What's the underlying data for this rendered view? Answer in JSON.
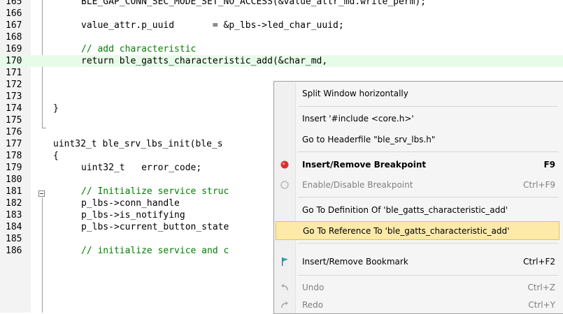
{
  "editor": {
    "lines": [
      {
        "num": "165",
        "code": "BLE_GAP_CONN_SEC_MODE_SET_NO_ACCESS(&value_attr_md.write_perm);",
        "kind": "plain"
      },
      {
        "num": "166",
        "code": "",
        "kind": "plain"
      },
      {
        "num": "167",
        "code": "value_attr.p_uuid       = &p_lbs->led_char_uuid;",
        "kind": "plain"
      },
      {
        "num": "168",
        "code": "",
        "kind": "plain"
      },
      {
        "num": "169",
        "code": "// add characteristic",
        "kind": "comment"
      },
      {
        "num": "170",
        "code": "return ble_gatts_characteristic_add(&char_md,",
        "kind": "highlight"
      },
      {
        "num": "171",
        "code": "",
        "kind": "plain"
      },
      {
        "num": "172",
        "code": "",
        "kind": "plain"
      },
      {
        "num": "173",
        "code": "",
        "kind": "plain"
      },
      {
        "num": "174",
        "code": "}",
        "kind": "plain"
      },
      {
        "num": "175",
        "code": "",
        "kind": "plain"
      },
      {
        "num": "176",
        "code": "",
        "kind": "plain"
      },
      {
        "num": "177",
        "code": "uint32_t ble_srv_lbs_init(ble_s",
        "kind": "plain"
      },
      {
        "num": "178",
        "code": "{",
        "kind": "plain"
      },
      {
        "num": "179",
        "code": "uint32_t   error_code;",
        "kind": "plain"
      },
      {
        "num": "180",
        "code": "",
        "kind": "plain"
      },
      {
        "num": "181",
        "code": "// Initialize service struc",
        "kind": "comment"
      },
      {
        "num": "182",
        "code": "p_lbs->conn_handle",
        "kind": "plain"
      },
      {
        "num": "183",
        "code": "p_lbs->is_notifying",
        "kind": "plain"
      },
      {
        "num": "184",
        "code": "p_lbs->current_button_state",
        "kind": "plain"
      },
      {
        "num": "185",
        "code": "",
        "kind": "plain"
      },
      {
        "num": "186",
        "code": "// initialize service and c",
        "kind": "comment"
      }
    ],
    "paren_glyph": ")"
  },
  "context_menu": {
    "items": [
      {
        "label": "Split Window horizontally",
        "shortcut": "",
        "bold": false,
        "disabled": false,
        "icon": ""
      },
      {
        "label": "Insert '#include <core.h>'",
        "shortcut": "",
        "bold": false,
        "disabled": false,
        "icon": ""
      },
      {
        "label": "Go to Headerfile \"ble_srv_lbs.h\"",
        "shortcut": "",
        "bold": false,
        "disabled": false,
        "icon": ""
      },
      {
        "label": "Insert/Remove Breakpoint",
        "shortcut": "F9",
        "bold": true,
        "disabled": false,
        "icon": "breakpoint-red-dot-icon"
      },
      {
        "label": "Enable/Disable Breakpoint",
        "shortcut": "Ctrl+F9",
        "bold": false,
        "disabled": true,
        "icon": "breakpoint-hollow-circle-icon"
      },
      {
        "label": "Go To Definition Of 'ble_gatts_characteristic_add'",
        "shortcut": "",
        "bold": false,
        "disabled": false,
        "icon": ""
      },
      {
        "label": "Go To Reference To 'ble_gatts_characteristic_add'",
        "shortcut": "",
        "bold": false,
        "disabled": false,
        "icon": "",
        "hover": true
      },
      {
        "label": "Insert/Remove Bookmark",
        "shortcut": "Ctrl+F2",
        "bold": false,
        "disabled": false,
        "icon": "bookmark-flag-icon"
      },
      {
        "label": "Undo",
        "shortcut": "Ctrl+Z",
        "bold": false,
        "disabled": true,
        "icon": "undo-icon"
      },
      {
        "label": "Redo",
        "shortcut": "Ctrl+Y",
        "bold": false,
        "disabled": true,
        "icon": "redo-icon"
      }
    ]
  },
  "colors": {
    "comment": "#008000",
    "keyword": "#0000ff",
    "highlight_line": "#e8fbe8",
    "menu_hover": "#fdeaa8",
    "breakpoint": "#d93030"
  }
}
